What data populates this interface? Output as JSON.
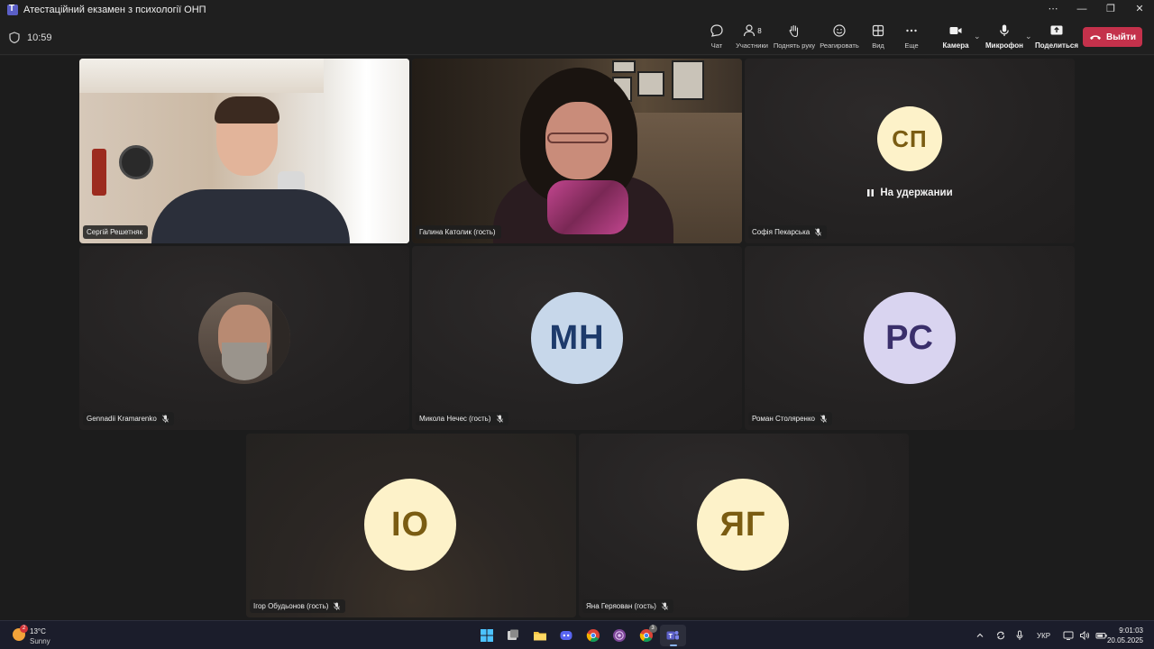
{
  "window": {
    "title": "Атестаційний екзамен з психології ОНП",
    "controls": [
      "⋯",
      "—",
      "❐",
      "✕"
    ]
  },
  "meeting": {
    "timer": "10:59",
    "toolbar": {
      "chat": "Чат",
      "participants": "Участники",
      "participants_count": "8",
      "raise_hand": "Поднять руку",
      "react": "Реагировать",
      "view": "Вид",
      "more": "Еще",
      "camera": "Камера",
      "microphone": "Микрофон",
      "share": "Поделиться",
      "leave": "Выйти"
    },
    "colors": {
      "leave_button": "#c4314b",
      "avatar_yellow": "#fdf2c9",
      "avatar_yellow_text": "#7a5c12",
      "avatar_blue": "#c7d7ea",
      "avatar_blue_text": "#1d3a6b",
      "avatar_lavender": "#d9d4f0",
      "avatar_lavender_text": "#3a2f6b"
    },
    "on_hold_label": "На удержании",
    "participants": [
      {
        "name": "Сергій Решетняк",
        "video": true
      },
      {
        "name": "Галина Католик (гость)",
        "video": true
      },
      {
        "name": "Софія Пекарська",
        "initials": "СП",
        "on_hold": true,
        "muted": true
      },
      {
        "name": "Gennadii Kramarenko",
        "photo": true,
        "muted": true
      },
      {
        "name": "Микола Нечес (гость)",
        "initials": "МН",
        "muted": true
      },
      {
        "name": "Роман Столяренко",
        "initials": "РС",
        "muted": true
      },
      {
        "name": "Ігор Обудьонов (гость)",
        "initials": "ІО",
        "muted": true
      },
      {
        "name": "Яна Геряован (гость)",
        "initials": "ЯГ",
        "muted": true
      }
    ]
  },
  "taskbar": {
    "weather_temp": "13°C",
    "weather_condition": "Sunny",
    "weather_badge": "2",
    "apps": [
      "windows-start",
      "task-view",
      "file-explorer",
      "discord",
      "chrome",
      "tor-browser",
      "chrome-profile",
      "teams"
    ],
    "chrome_profile_badge": "3",
    "language": "УКР",
    "time": "9:01:03",
    "date": "20.05.2025"
  }
}
